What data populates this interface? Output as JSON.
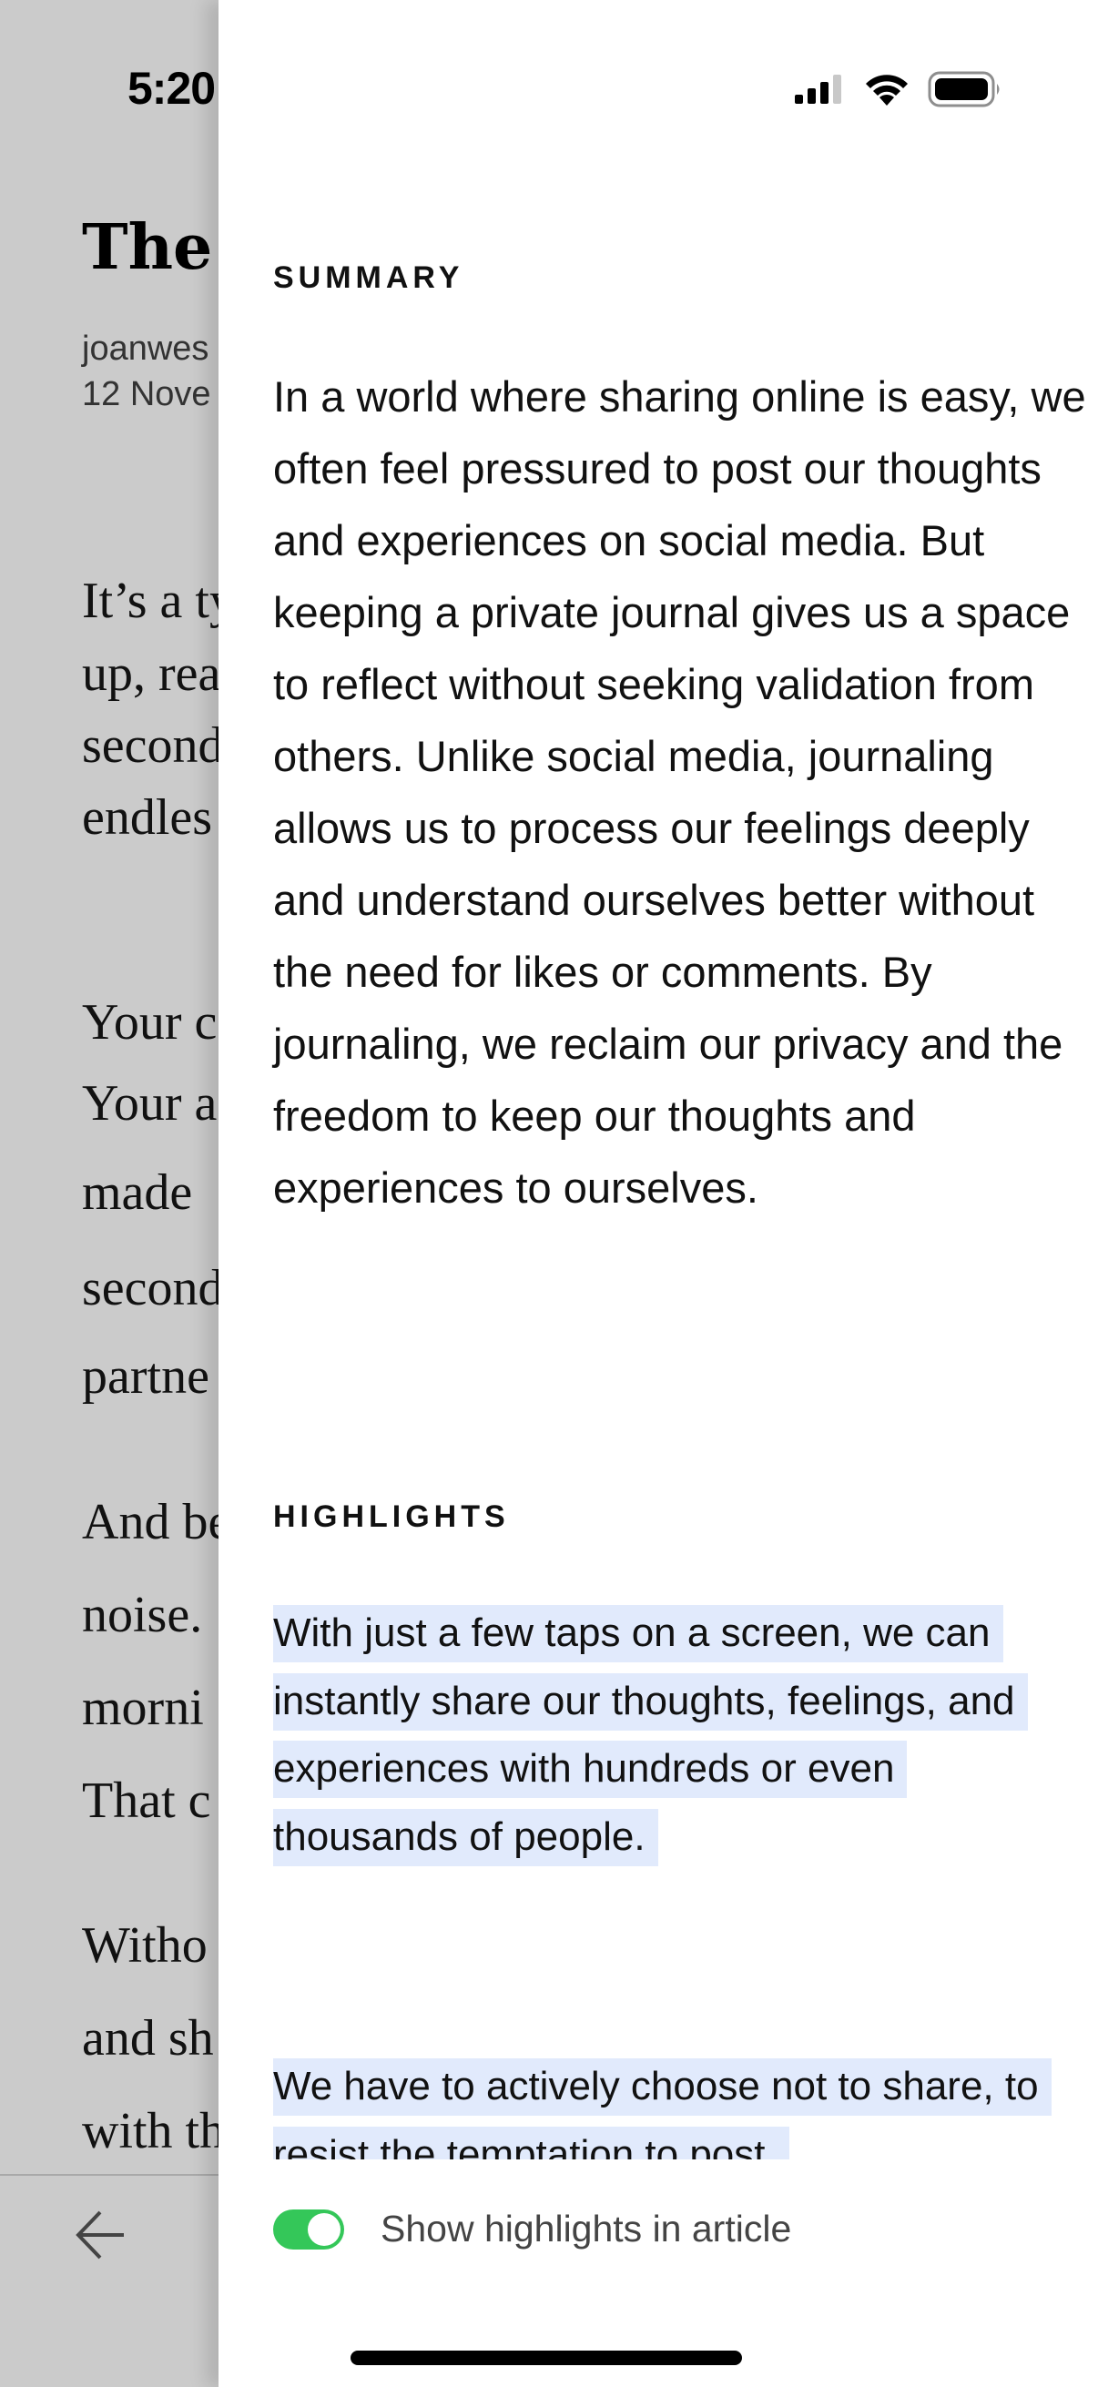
{
  "status_bar": {
    "time": "5:20",
    "icons": [
      "bell-slash-icon",
      "cellular-signal-icon",
      "wifi-icon",
      "battery-icon"
    ]
  },
  "article": {
    "title_fragment": "The",
    "author_fragment": "joanwes",
    "date_fragment": "12 Nove",
    "body_fragments": [
      "It’s a ty",
      "up, rea",
      "second",
      "endles",
      "Your c",
      "Your a",
      "made",
      "second",
      "partne",
      "And be",
      "noise.",
      "morni",
      "That c",
      "Witho",
      "and sh",
      "with th"
    ],
    "back_icon": "arrow-left-icon"
  },
  "panel": {
    "summary_title": "SUMMARY",
    "summary_text": "In a world where sharing online is easy, we often feel pressured to post our thoughts and experiences on social media. But keeping a private journal gives us a space to reflect without seeking validation from others. Unlike social media, journaling allows us to process our feelings deeply and understand ourselves better without the need for likes or comments. By journaling, we reclaim our privacy and the freedom to keep our thoughts and experiences to ourselves.",
    "highlights_title": "HIGHLIGHTS",
    "highlights": [
      "With just a few taps on a screen, we can instantly share our thoughts, feelings, and experiences with hundreds or even thousands of people.",
      "We have to actively choose not to share, to resist the temptation to post,"
    ],
    "highlight_color": "#e1eafc",
    "toggle": {
      "label": "Show highlights in article",
      "on": true,
      "color": "#34c759"
    }
  }
}
